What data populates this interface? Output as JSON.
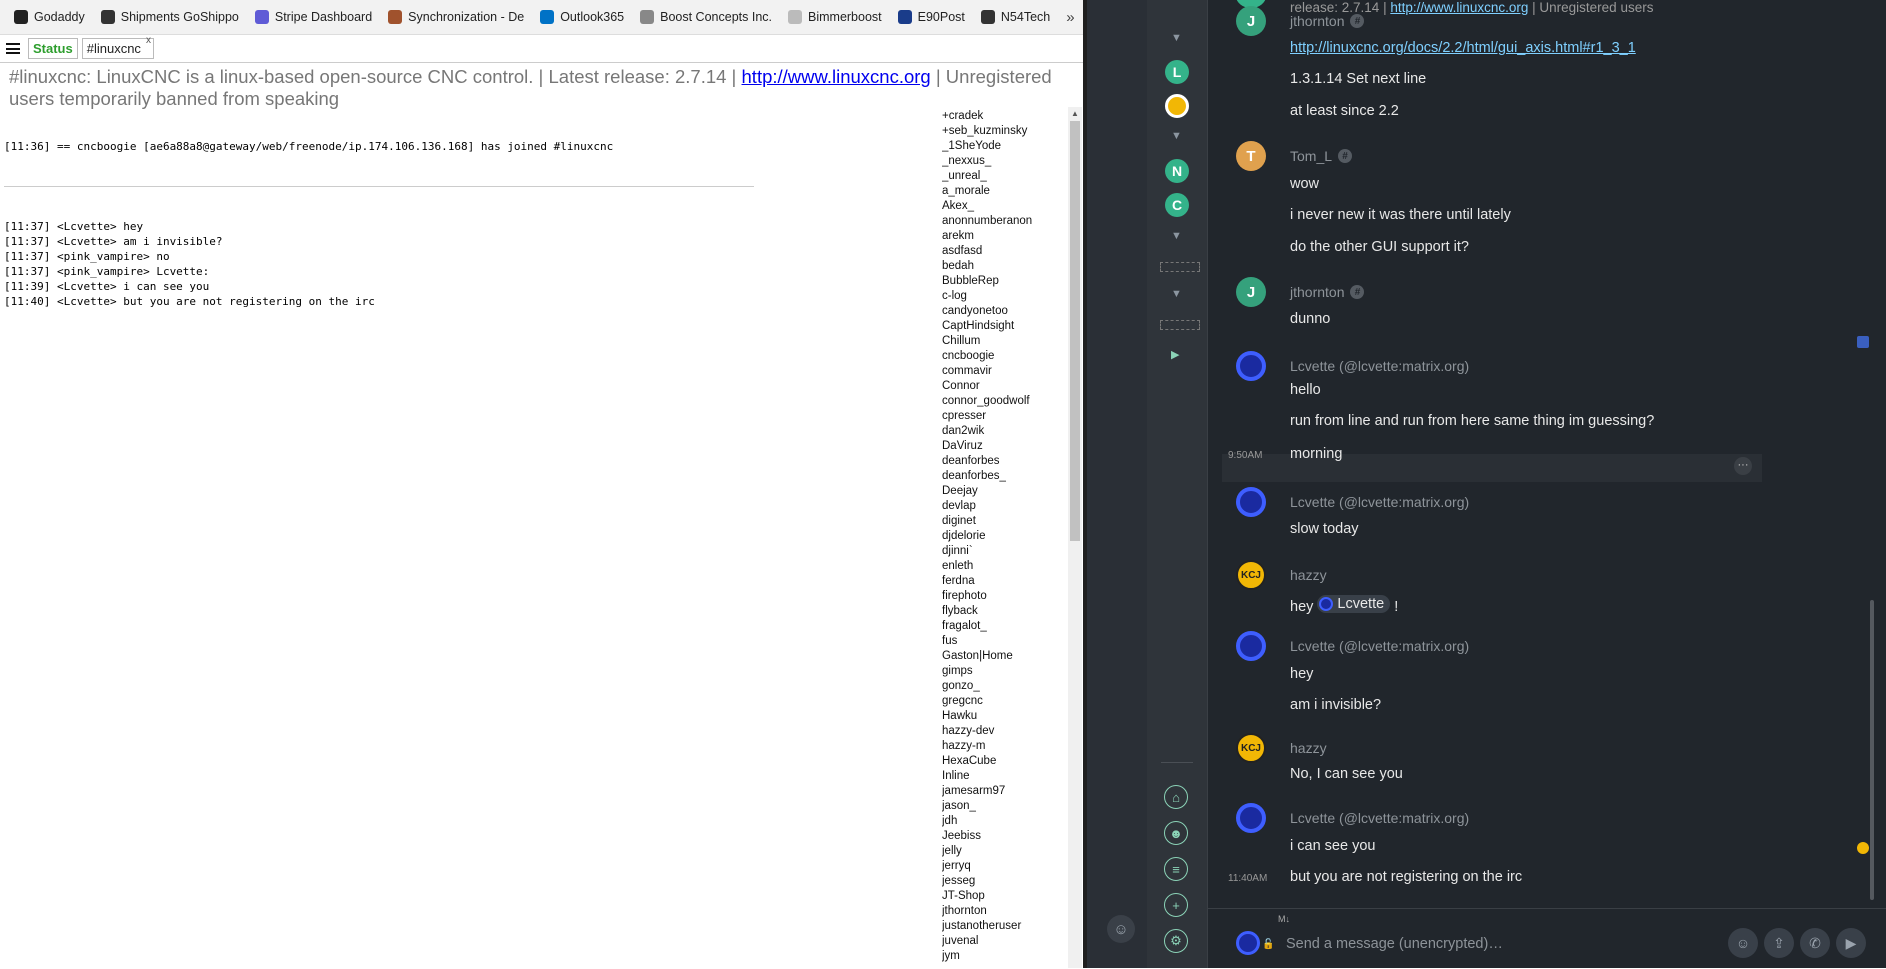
{
  "bookmarks": {
    "items": [
      {
        "label": "Godaddy",
        "color": "#222"
      },
      {
        "label": "Shipments GoShippo",
        "color": "#333"
      },
      {
        "label": "Stripe Dashboard",
        "color": "#5f5bd6"
      },
      {
        "label": "Synchronization - De",
        "color": "#a0522d"
      },
      {
        "label": "Outlook365",
        "color": "#0072c6"
      },
      {
        "label": "Boost Concepts Inc.",
        "color": "#888"
      },
      {
        "label": "Bimmerboost",
        "color": "#bbb"
      },
      {
        "label": "E90Post",
        "color": "#1a3c8a"
      },
      {
        "label": "N54Tech",
        "color": "#333"
      }
    ],
    "more": "»"
  },
  "webchat": {
    "tabs": {
      "status": "Status",
      "channel": "#linuxcnc",
      "close": "x"
    },
    "topic": {
      "prefix": "#linuxcnc: LinuxCNC is a linux-based open-source CNC control. | Latest release: 2.7.14 | ",
      "link": "http://www.linuxcnc.org",
      "suffix": " | Unregistered users temporarily banned from speaking"
    },
    "join_line": "[11:36] == cncboogie [ae6a88a8@gateway/web/freenode/ip.174.106.136.168] has joined #linuxcnc",
    "messages": [
      "[11:37] <Lcvette> hey",
      "[11:37] <Lcvette> am i invisible?",
      "[11:37] <pink_vampire> no",
      "[11:37] <pink_vampire> Lcvette:",
      "[11:39] <Lcvette> i can see you",
      "[11:40] <Lcvette> but you are not registering on the irc"
    ],
    "nicks": [
      "+cradek",
      "+seb_kuzminsky",
      "_1SheYode",
      "_nexxus_",
      "_unreal_",
      "a_morale",
      "Akex_",
      "anonnumberanon",
      "arekm",
      "asdfasd",
      "bedah",
      "BubbleRep",
      "c-log",
      "candyonetoo",
      "CaptHindsight",
      "Chillum",
      "cncboogie",
      "commavir",
      "Connor",
      "connor_goodwolf",
      "cpresser",
      "dan2wik",
      "DaViruz",
      "deanforbes",
      "deanforbes_",
      "Deejay",
      "devlap",
      "diginet",
      "djdelorie",
      "djinni`",
      "enleth",
      "ferdna",
      "firephoto",
      "flyback",
      "fragalot_",
      "fus",
      "Gaston|Home",
      "gimps",
      "gonzo_",
      "gregcnc",
      "Hawku",
      "hazzy-dev",
      "hazzy-m",
      "HexaCube",
      "Inline",
      "jamesarm97",
      "jason_",
      "jdh",
      "Jeebiss",
      "jelly",
      "jerryq",
      "jesseg",
      "JT-Shop",
      "jthornton",
      "justanotheruser",
      "juvenal",
      "jym"
    ]
  },
  "matrix": {
    "top_cut": {
      "prefix": "release: 2.7.14 | ",
      "link": "http://www.linuxcnc.org",
      "suffix": " | Unregistered users"
    },
    "room_avatars": [
      {
        "letter": "L",
        "color": "#34b38a"
      },
      {
        "letter": "N",
        "color": "#34b38a"
      },
      {
        "letter": "C",
        "color": "#34b38a"
      }
    ],
    "timeline": [
      {
        "type": "sender",
        "name": "jthornton",
        "avatar": "J",
        "color": "#35a17c",
        "hash": true
      },
      {
        "type": "link",
        "text": "http://linuxcnc.org/docs/2.2/html/gui_axis.html#r1_3_1"
      },
      {
        "type": "text",
        "text": "1.3.1.14 Set next line"
      },
      {
        "type": "text",
        "text": "at least since 2.2"
      },
      {
        "type": "sender",
        "name": "Tom_L",
        "avatar": "T",
        "color": "#e0a14e",
        "hash": true
      },
      {
        "type": "text",
        "text": "wow"
      },
      {
        "type": "text",
        "text": "i never new it was there until lately"
      },
      {
        "type": "text",
        "text": "do the other GUI support it?"
      },
      {
        "type": "sender",
        "name": "jthornton",
        "avatar": "J",
        "color": "#35a17c",
        "hash": true
      },
      {
        "type": "text",
        "text": "dunno"
      },
      {
        "type": "sender",
        "name": "Lcvette (@lcvette:matrix.org)",
        "avatar": "",
        "color": "#1a2aa0",
        "hash": false
      },
      {
        "type": "text",
        "text": "hello"
      },
      {
        "type": "text",
        "text": "run from line and run from here same thing im guessing?"
      },
      {
        "type": "text",
        "text": "morning",
        "ts": "9:50AM",
        "hover": true
      },
      {
        "type": "sender",
        "name": "Lcvette (@lcvette:matrix.org)",
        "avatar": "",
        "color": "#1a2aa0",
        "hash": false
      },
      {
        "type": "text",
        "text": "slow today"
      },
      {
        "type": "sender",
        "name": "hazzy",
        "avatar": "KCJ",
        "color": "#f2b705",
        "hash": false
      },
      {
        "type": "mention",
        "before": "hey ",
        "pill": "Lcvette",
        "after": " !"
      },
      {
        "type": "sender",
        "name": "Lcvette (@lcvette:matrix.org)",
        "avatar": "",
        "color": "#1a2aa0",
        "hash": false
      },
      {
        "type": "text",
        "text": "hey"
      },
      {
        "type": "text",
        "text": "am i invisible?"
      },
      {
        "type": "sender",
        "name": "hazzy",
        "avatar": "KCJ",
        "color": "#f2b705",
        "hash": false
      },
      {
        "type": "text",
        "text": "No, I can see you"
      },
      {
        "type": "sender",
        "name": "Lcvette (@lcvette:matrix.org)",
        "avatar": "",
        "color": "#1a2aa0",
        "hash": false
      },
      {
        "type": "text",
        "text": "i can see you"
      },
      {
        "type": "text",
        "text": "but you are not registering on the irc",
        "ts": "11:40AM"
      }
    ],
    "composer": {
      "placeholder": "Send a message (unencrypted)…"
    }
  }
}
